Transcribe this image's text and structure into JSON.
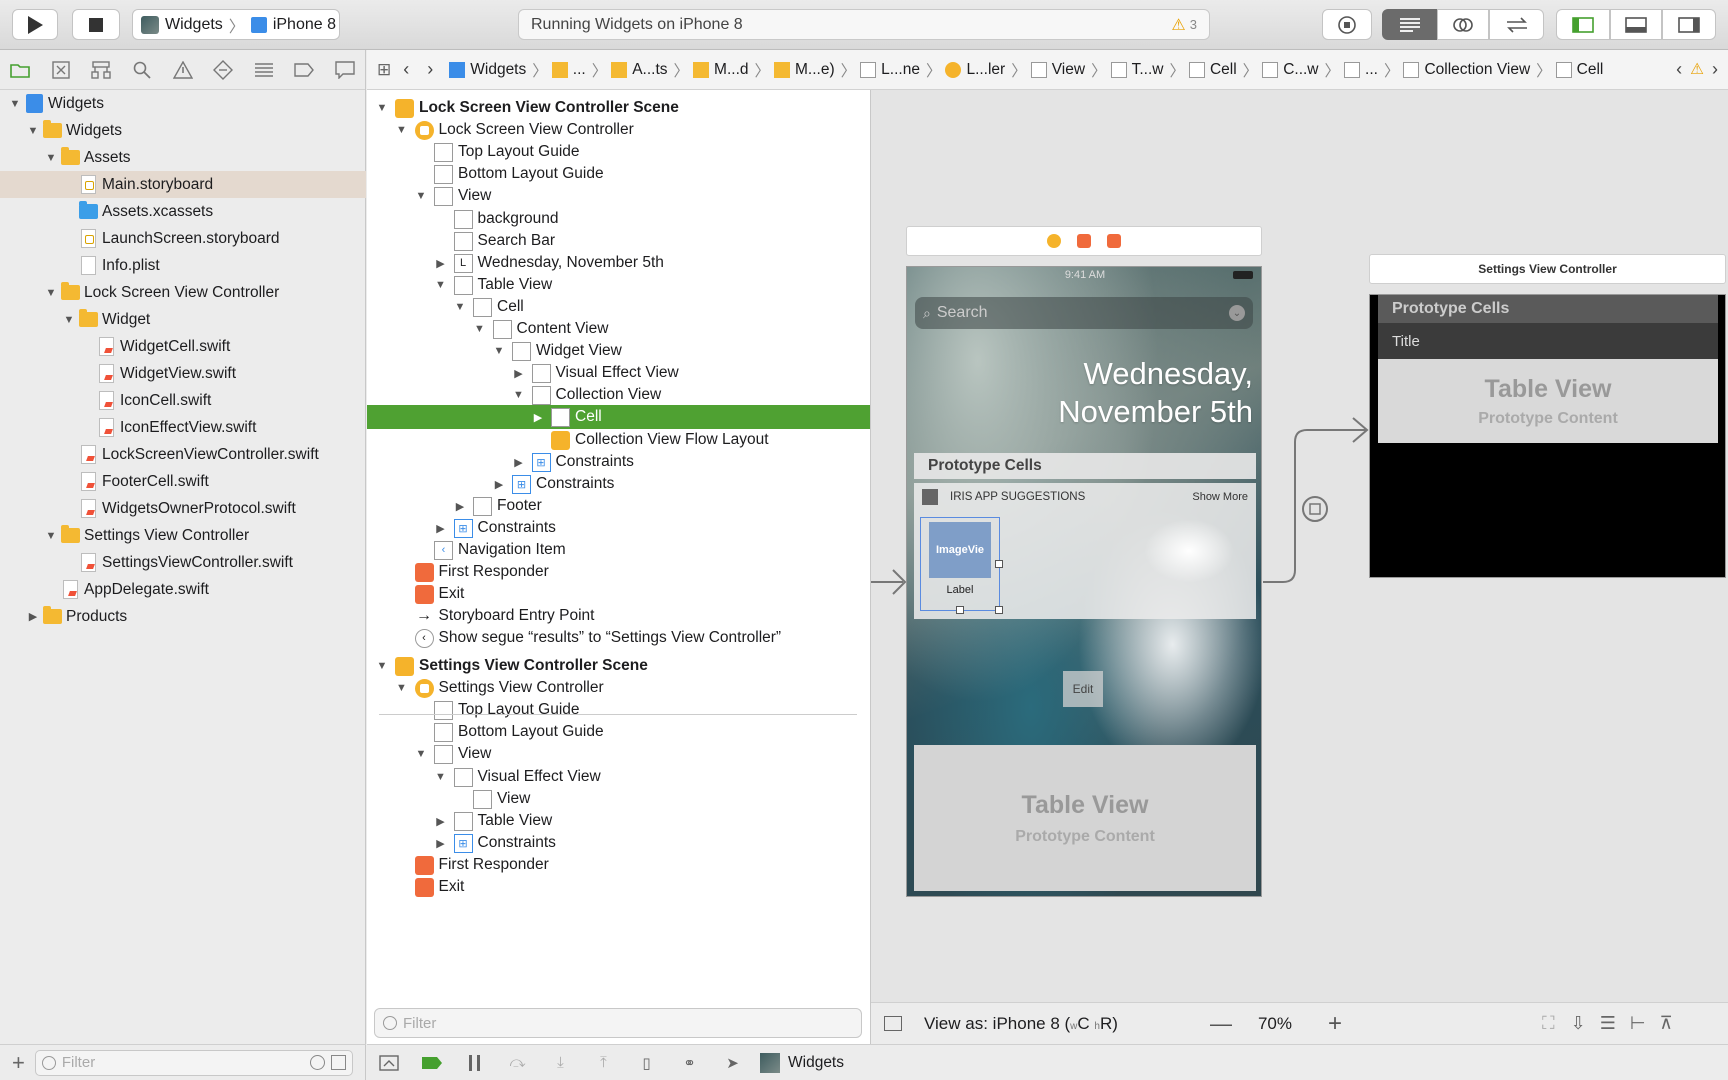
{
  "toolbar": {
    "scheme_target": "Widgets",
    "scheme_device": "iPhone 8",
    "activity": "Running Widgets on iPhone 8",
    "warning_count": "3"
  },
  "navigator": {
    "rows": [
      {
        "label": "Widgets",
        "indent": 0,
        "tri": "▼",
        "icon": "project"
      },
      {
        "label": "Widgets",
        "indent": 1,
        "tri": "▼",
        "icon": "folder"
      },
      {
        "label": "Assets",
        "indent": 2,
        "tri": "▼",
        "icon": "folder"
      },
      {
        "label": "Main.storyboard",
        "indent": 3,
        "tri": "",
        "icon": "storyboard",
        "selected": true
      },
      {
        "label": "Assets.xcassets",
        "indent": 3,
        "tri": "",
        "icon": "folder-blue"
      },
      {
        "label": "LaunchScreen.storyboard",
        "indent": 3,
        "tri": "",
        "icon": "storyboard"
      },
      {
        "label": "Info.plist",
        "indent": 3,
        "tri": "",
        "icon": "plist"
      },
      {
        "label": "Lock Screen View Controller",
        "indent": 2,
        "tri": "▼",
        "icon": "folder"
      },
      {
        "label": "Widget",
        "indent": 3,
        "tri": "▼",
        "icon": "folder"
      },
      {
        "label": "WidgetCell.swift",
        "indent": 4,
        "tri": "",
        "icon": "swift"
      },
      {
        "label": "WidgetView.swift",
        "indent": 4,
        "tri": "",
        "icon": "swift"
      },
      {
        "label": "IconCell.swift",
        "indent": 4,
        "tri": "",
        "icon": "swift"
      },
      {
        "label": "IconEffectView.swift",
        "indent": 4,
        "tri": "",
        "icon": "swift"
      },
      {
        "label": "LockScreenViewController.swift",
        "indent": 3,
        "tri": "",
        "icon": "swift"
      },
      {
        "label": "FooterCell.swift",
        "indent": 3,
        "tri": "",
        "icon": "swift"
      },
      {
        "label": "WidgetsOwnerProtocol.swift",
        "indent": 3,
        "tri": "",
        "icon": "swift"
      },
      {
        "label": "Settings View Controller",
        "indent": 2,
        "tri": "▼",
        "icon": "folder"
      },
      {
        "label": "SettingsViewController.swift",
        "indent": 3,
        "tri": "",
        "icon": "swift"
      },
      {
        "label": "AppDelegate.swift",
        "indent": 2,
        "tri": "",
        "icon": "swift"
      },
      {
        "label": "Products",
        "indent": 1,
        "tri": "▶",
        "icon": "folder"
      }
    ],
    "filter_placeholder": "Filter"
  },
  "jumpbar": {
    "items": [
      "Widgets",
      "...",
      "A...ts",
      "M...d",
      "M...e)",
      "L...ne",
      "L...ler",
      "View",
      "T...w",
      "Cell",
      "C...w",
      "...",
      "Collection View",
      "Cell"
    ]
  },
  "outline": {
    "rows": [
      {
        "label": "Lock Screen View Controller Scene",
        "indent": 0,
        "tri": "▼",
        "icon": "scene",
        "bold": true
      },
      {
        "label": "Lock Screen View Controller",
        "indent": 1,
        "tri": "▼",
        "icon": "vc"
      },
      {
        "label": "Top Layout Guide",
        "indent": 2,
        "tri": "",
        "icon": "box"
      },
      {
        "label": "Bottom Layout Guide",
        "indent": 2,
        "tri": "",
        "icon": "box"
      },
      {
        "label": "View",
        "indent": 2,
        "tri": "▼",
        "icon": "box"
      },
      {
        "label": "background",
        "indent": 3,
        "tri": "",
        "icon": "box"
      },
      {
        "label": "Search Bar",
        "indent": 3,
        "tri": "",
        "icon": "box"
      },
      {
        "label": "Wednesday, November 5th",
        "indent": 3,
        "tri": "▶",
        "icon": "L"
      },
      {
        "label": "Table View",
        "indent": 3,
        "tri": "▼",
        "icon": "box"
      },
      {
        "label": "Cell",
        "indent": 4,
        "tri": "▼",
        "icon": "box"
      },
      {
        "label": "Content View",
        "indent": 5,
        "tri": "▼",
        "icon": "box"
      },
      {
        "label": "Widget View",
        "indent": 6,
        "tri": "▼",
        "icon": "box"
      },
      {
        "label": "Visual Effect View",
        "indent": 7,
        "tri": "▶",
        "icon": "box"
      },
      {
        "label": "Collection View",
        "indent": 7,
        "tri": "▼",
        "icon": "box"
      },
      {
        "label": "Cell",
        "indent": 8,
        "tri": "▶",
        "icon": "box",
        "selected": true
      },
      {
        "label": "Collection View Flow Layout",
        "indent": 8,
        "tri": "",
        "icon": "cube"
      },
      {
        "label": "Constraints",
        "indent": 7,
        "tri": "▶",
        "icon": "cons"
      },
      {
        "label": "Constraints",
        "indent": 6,
        "tri": "▶",
        "icon": "cons"
      },
      {
        "label": "Footer",
        "indent": 4,
        "tri": "▶",
        "icon": "box"
      },
      {
        "label": "Constraints",
        "indent": 3,
        "tri": "▶",
        "icon": "cons"
      },
      {
        "label": "Navigation Item",
        "indent": 2,
        "tri": "",
        "icon": "nav"
      },
      {
        "label": "First Responder",
        "indent": 1,
        "tri": "",
        "icon": "fr"
      },
      {
        "label": "Exit",
        "indent": 1,
        "tri": "",
        "icon": "fr"
      },
      {
        "label": "Storyboard Entry Point",
        "indent": 1,
        "tri": "",
        "icon": "arrow"
      },
      {
        "label": "Show segue “results” to “Settings View Controller”",
        "indent": 1,
        "tri": "",
        "icon": "segue"
      },
      {
        "label": "Settings View Controller Scene",
        "indent": 0,
        "tri": "▼",
        "icon": "scene",
        "bold": true
      },
      {
        "label": "Settings View Controller",
        "indent": 1,
        "tri": "▼",
        "icon": "vc"
      },
      {
        "label": "Top Layout Guide",
        "indent": 2,
        "tri": "",
        "icon": "box"
      },
      {
        "label": "Bottom Layout Guide",
        "indent": 2,
        "tri": "",
        "icon": "box"
      },
      {
        "label": "View",
        "indent": 2,
        "tri": "▼",
        "icon": "box"
      },
      {
        "label": "Visual Effect View",
        "indent": 3,
        "tri": "▼",
        "icon": "box"
      },
      {
        "label": "View",
        "indent": 4,
        "tri": "",
        "icon": "box"
      },
      {
        "label": "Table View",
        "indent": 3,
        "tri": "▶",
        "icon": "box"
      },
      {
        "label": "Constraints",
        "indent": 3,
        "tri": "▶",
        "icon": "cons"
      },
      {
        "label": "First Responder",
        "indent": 1,
        "tri": "",
        "icon": "fr"
      },
      {
        "label": "Exit",
        "indent": 1,
        "tri": "",
        "icon": "fr"
      }
    ],
    "filter_placeholder": "Filter"
  },
  "phone": {
    "time": "9:41 AM",
    "search": "Search",
    "date_line1": "Wednesday,",
    "date_line2": "November 5th",
    "proto_cells": "Prototype Cells",
    "widget_title": "IRIS APP SUGGESTIONS",
    "show_more": "Show More",
    "image_view": "ImageVie",
    "cell_label": "Label",
    "edit": "Edit",
    "table_view": "Table View",
    "proto_content": "Prototype Content"
  },
  "settings_scene": {
    "title": "Settings View Controller",
    "proto_cells": "Prototype Cells",
    "cell_title": "Title",
    "table_view": "Table View",
    "proto_content": "Prototype Content"
  },
  "canvas_footer": {
    "view_as": "View as: iPhone 8 (",
    "wc": "w",
    "c": "C",
    "hr": "h",
    "r": "R)",
    "zoom": "70%"
  },
  "debug": {
    "target": "Widgets"
  },
  "colors": {
    "selection": "#4fa132",
    "accent": "#f5b32b"
  }
}
